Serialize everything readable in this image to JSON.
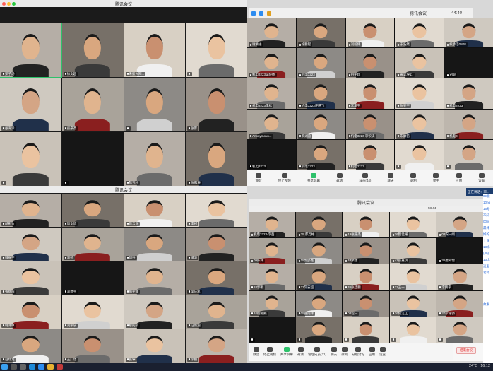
{
  "windows": {
    "tl": {
      "title": "腾讯会议"
    },
    "tr": {
      "title": "腾讯会议",
      "time": "44:40"
    },
    "bl": {
      "title": "腾讯会议"
    },
    "br": {
      "title": "腾讯会议",
      "time": "58:44"
    }
  },
  "tl_tiles": [
    {
      "name": "梁子炀"
    },
    {
      "name": "徐文超"
    },
    {
      "name": "未接入网..."
    },
    {
      "name": ""
    },
    {
      "name": "张海洋"
    },
    {
      "name": "张豪杰"
    },
    {
      "name": ""
    },
    {
      "name": "张影"
    },
    {
      "name": ""
    },
    {
      "name": ""
    },
    {
      "name": "陈五杉"
    },
    {
      "name": "张露涛"
    },
    {
      "name": "高航天"
    },
    {
      "name": "杨晓康"
    }
  ],
  "tr_tiles": [
    {
      "name": "谢清进"
    },
    {
      "name": "徐鹏程"
    },
    {
      "name": "刘毅伟"
    },
    {
      "name": "于浩然"
    },
    {
      "name": "候承洁0808"
    },
    {
      "name": "机电3223吴晓杨"
    },
    {
      "name": "机电3223"
    },
    {
      "name": "冉宇翔"
    },
    {
      "name": "黄昊坤11"
    },
    {
      "name": "刘毅"
    },
    {
      "name": "机电3223李松"
    },
    {
      "name": "机电3223许腾飞"
    },
    {
      "name": "李泽宇"
    },
    {
      "name": "张天宇"
    },
    {
      "name": "机电3223"
    },
    {
      "name": "Anonymous..."
    },
    {
      "name": "罗湖畲"
    },
    {
      "name": "机电3223 李钦琪"
    },
    {
      "name": "朱康蘅"
    },
    {
      "name": "机电3"
    },
    {
      "name": "机电3223"
    },
    {
      "name": "机电3223"
    },
    {
      "name": "机电3223"
    },
    {
      "name": ""
    },
    {
      "name": ""
    }
  ],
  "tr_toolbar": [
    "静音",
    "停止视频",
    "共享屏幕",
    "邀请",
    "成员(44)",
    "聊天",
    "录制",
    "举手",
    "应用",
    "设置"
  ],
  "bl_tiles": [
    {
      "name": "赫彰竹"
    },
    {
      "name": "唐文博"
    },
    {
      "name": "唐云龙"
    },
    {
      "name": "李柯"
    },
    {
      "name": "魏振宇"
    },
    {
      "name": "刘畅"
    },
    {
      "name": "刘升"
    },
    {
      "name": "潘源"
    },
    {
      "name": "张锦阳"
    },
    {
      "name": "刘建宇"
    },
    {
      "name": "郝宇泽"
    },
    {
      "name": "李庆凯"
    },
    {
      "name": "韩泽甲"
    },
    {
      "name": "刘宇乐"
    },
    {
      "name": "解闪良"
    },
    {
      "name": "汪新迪"
    },
    {
      "name": "赵翔龙"
    },
    {
      "name": "王广达"
    },
    {
      "name": "张坤"
    },
    {
      "name": "李鹏"
    }
  ],
  "br_tiles": [
    {
      "name": "机电3223-李西"
    },
    {
      "name": "35 郝万彬"
    },
    {
      "name": "19张浩杰"
    },
    {
      "name": "16魏佳耀"
    },
    {
      "name": "02安一闻"
    },
    {
      "name": "09陈伟"
    },
    {
      "name": "15郭邵鑫"
    },
    {
      "name": "43余捷"
    },
    {
      "name": "47张嘉琪"
    },
    {
      "name": "36唐阿怡"
    },
    {
      "name": "18郭明"
    },
    {
      "name": "33常安超"
    },
    {
      "name": "46张佳鹏"
    },
    {
      "name": "37王一"
    },
    {
      "name": "李鹏宇"
    },
    {
      "name": "34杨瀚熙"
    },
    {
      "name": "05张雨洋"
    },
    {
      "name": "08程一"
    },
    {
      "name": "16何江江"
    },
    {
      "name": "20李铭骄"
    },
    {
      "name": ""
    },
    {
      "name": ""
    },
    {
      "name": ""
    },
    {
      "name": ""
    },
    {
      "name": ""
    }
  ],
  "br_toolbar": [
    "静音",
    "停止视频",
    "共享屏幕",
    "邀请",
    "管理成员(31)",
    "聊天",
    "录制",
    "分组讨论",
    "应用",
    "设置"
  ],
  "br_end_button": "结束会议",
  "notice": "正在讲话：李...",
  "sidebar_lines": [
    "09能",
    "10ng",
    "16号",
    "不知",
    "00前",
    "最棒",
    "好的",
    "上课",
    "13比",
    "(40)",
    "13比",
    "这里",
    "老师",
    "",
    "",
    "",
    "",
    "故发"
  ],
  "taskbar": {
    "time": "16:12",
    "temp": "24°C"
  },
  "colors": {
    "accent": "#3a7bd5",
    "end": "#e02f2f",
    "speaking": "#2ec16b"
  }
}
